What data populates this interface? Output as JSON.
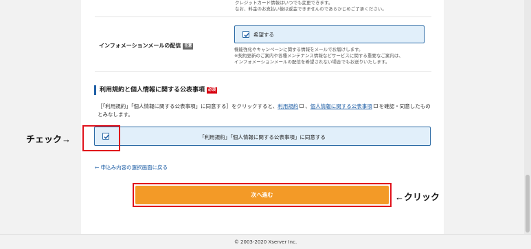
{
  "top_note": {
    "line1": "クレジットカード情報はいつでも変更できます。",
    "line2": "なお、料金のお支払い後は返金できませんのであらかじめご了承ください。"
  },
  "info_mail": {
    "label": "インフォメーションメールの配信",
    "badge": "任意",
    "checkbox_label": "希望する",
    "checked": true,
    "note_line1": "機能強化やキャンペーンに関する情報をメールでお届けします。",
    "note_line2": "※契約更新のご案内や各種メンテナンス情報などサービスに関する重要なご案内は、",
    "note_line3": "インフォメーションメールの配信を希望されない場合でもお送りいたします。"
  },
  "terms": {
    "title": "利用規約と個人情報に関する公表事項",
    "badge": "必須",
    "text_before": "［「利用規約」「個人情報に関する公表事項」に同意する］をクリックすると、",
    "link1": "利用規約",
    "separator": "、",
    "link2": "個人情報に関する公表事項",
    "text_after": "を確認・同意したものとみなします。",
    "agree_label": "「利用規約」「個人情報に関する公表事項」に同意する",
    "checked": true
  },
  "annotations": {
    "check": "チェック→",
    "click": "←クリック"
  },
  "back_link": "← 申込み内容の選択画面に戻る",
  "next_button": "次へ進む",
  "footer": "© 2003-2020 Xserver Inc.",
  "colors": {
    "accent_blue": "#2b6aa5",
    "button_orange": "#f39a27",
    "required_red": "#d7000f",
    "annotation_red": "#e0101a"
  }
}
